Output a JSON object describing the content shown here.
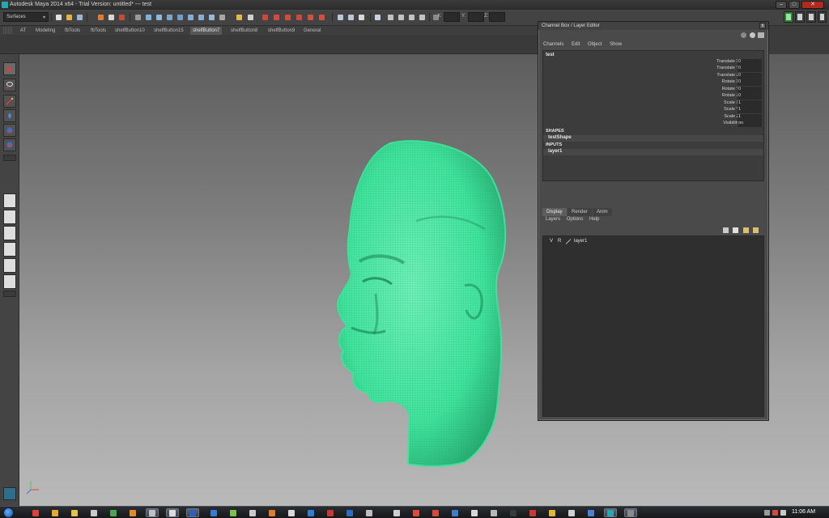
{
  "window": {
    "title": "Autodesk Maya 2014 x64 - Trial Version: untitled*   ---   test",
    "minimize_glyph": "–",
    "maximize_glyph": "□",
    "close_glyph": "✕"
  },
  "status_line": {
    "menu_set": "Surfaces",
    "coord_labels": [
      "X:",
      "Y:",
      "Z:"
    ]
  },
  "shelf": {
    "tabs": [
      "AT",
      "Modeling",
      "fbTools",
      "fbTools",
      "shelfButton10",
      "shelfButton15",
      "shelfButton7",
      "shelfButton8",
      "shelfButton9",
      "General"
    ],
    "active_tab": "shelfButton7"
  },
  "channel_box": {
    "window_title": "Channel Box / Layer Editor",
    "close_glyph": "x",
    "menus": [
      "Channels",
      "Edit",
      "Object",
      "Show"
    ],
    "object_name": "test",
    "attributes": [
      {
        "label": "Translate X",
        "value": "0"
      },
      {
        "label": "Translate Y",
        "value": "0"
      },
      {
        "label": "Translate Z",
        "value": "0"
      },
      {
        "label": "Rotate X",
        "value": "0"
      },
      {
        "label": "Rotate Y",
        "value": "0"
      },
      {
        "label": "Rotate Z",
        "value": "0"
      },
      {
        "label": "Scale X",
        "value": "1"
      },
      {
        "label": "Scale Y",
        "value": "1"
      },
      {
        "label": "Scale Z",
        "value": "1"
      },
      {
        "label": "Visibility",
        "value": "on"
      }
    ],
    "shapes_header": "SHAPES",
    "shape_name": "testShape",
    "inputs_header": "INPUTS",
    "input_name": "layer1"
  },
  "layer_editor": {
    "tabs": [
      "Display",
      "Render",
      "Anim"
    ],
    "active_tab": "Display",
    "menus": [
      "Layers",
      "Options",
      "Help"
    ],
    "layers": [
      {
        "visible": "V",
        "render": "R",
        "name": "layer1",
        "color": "#d9d9d9"
      }
    ]
  },
  "viewport": {
    "mesh_color": "#3fe39c",
    "background_top": "#5d5d5d",
    "background_bottom": "#b9b9b9"
  },
  "taskbar": {
    "clock": "11:06 AM"
  },
  "colors": {
    "accent_selection": "#3fe39c",
    "close_red": "#b02a1e",
    "maya_teal": "#27a6b5"
  }
}
